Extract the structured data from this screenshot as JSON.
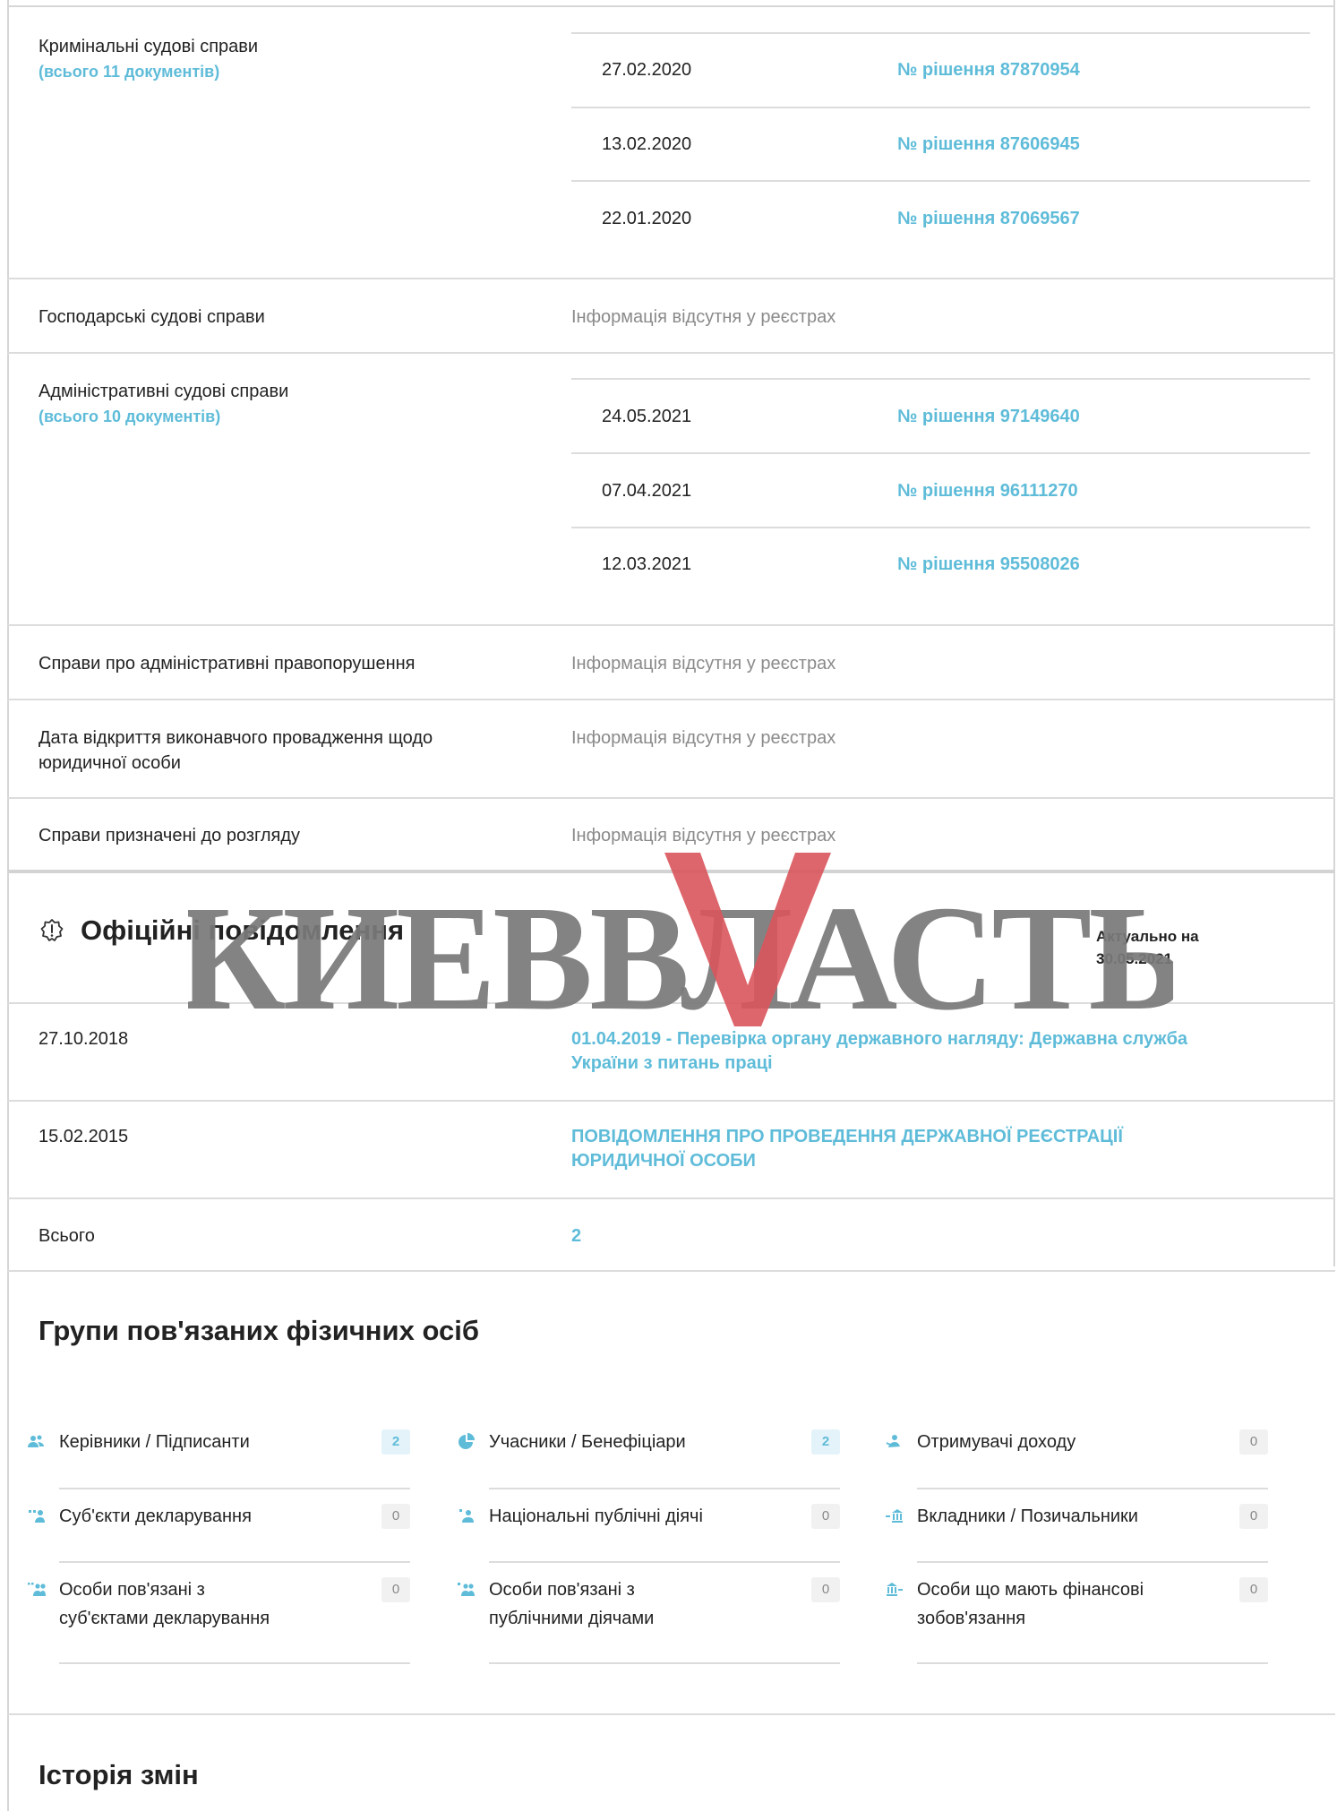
{
  "court": {
    "criminal": {
      "label": "Кримінальні судові справи",
      "count": "(всього 11 документів)",
      "rows": [
        {
          "date": "27.02.2020",
          "decision": "№ рішення 87870954"
        },
        {
          "date": "13.02.2020",
          "decision": "№ рішення 87606945"
        },
        {
          "date": "22.01.2020",
          "decision": "№ рішення 87069567"
        }
      ]
    },
    "commercial": {
      "label": "Господарські судові справи",
      "value": "Інформація відсутня у реєстрах"
    },
    "administrative": {
      "label": "Адміністративні судові справи",
      "count": "(всього 10 документів)",
      "rows": [
        {
          "date": "24.05.2021",
          "decision": "№ рішення 97149640"
        },
        {
          "date": "07.04.2021",
          "decision": "№ рішення 96111270"
        },
        {
          "date": "12.03.2021",
          "decision": "№ рішення 95508026"
        }
      ]
    },
    "offenses": {
      "label": "Справи про адміністративні правопорушення",
      "value": "Інформація відсутня у реєстрах"
    },
    "enforcement": {
      "label_line1": "Дата відкриття виконавчого провадження щодо",
      "label_line2": "юридичної особи",
      "value": "Інформація відсутня у реєстрах"
    },
    "scheduled": {
      "label": "Справи призначені до розгляду",
      "value": "Інформація відсутня у реєстрах"
    }
  },
  "notices": {
    "title": "Офіційні повідомлення",
    "actual_line1": "Актуально на",
    "actual_line2": "30.05.2021",
    "rows": [
      {
        "date": "27.10.2018",
        "line1": "01.04.2019 - Перевірка органу державного нагляду: Державна служба",
        "line2": "України з питань праці"
      },
      {
        "date": "15.02.2015",
        "line1": "ПОВІДОМЛЕННЯ ПРО ПРОВЕДЕННЯ ДЕРЖАВНОЇ РЕЄСТРАЦІЇ",
        "line2": "ЮРИДИЧНОЇ ОСОБИ"
      }
    ],
    "total_label": "Всього",
    "total_value": "2"
  },
  "groups": {
    "title": "Групи пов'язаних фізичних осіб",
    "items": [
      {
        "line1": "Керівники / Підписанти",
        "line2": "",
        "count": "2",
        "icon": "people-icon"
      },
      {
        "line1": "Учасники / Бенефіціари",
        "line2": "",
        "count": "2",
        "icon": "pie-chart-icon"
      },
      {
        "line1": "Отримувачі доходу",
        "line2": "",
        "count": "0",
        "icon": "income-person-icon"
      },
      {
        "line1": "Суб'єкти декларування",
        "line2": "",
        "count": "0",
        "icon": "declarant-icon"
      },
      {
        "line1": "Національні публічні діячі",
        "line2": "",
        "count": "0",
        "icon": "public-figure-icon"
      },
      {
        "line1": "Вкладники / Позичальники",
        "line2": "",
        "count": "0",
        "icon": "bank-depositor-icon"
      },
      {
        "line1": "Особи пов'язані з",
        "line2": "суб'єктами декларування",
        "count": "0",
        "icon": "declarant-related-icon"
      },
      {
        "line1": "Особи пов'язані з",
        "line2": "публічними діячами",
        "count": "0",
        "icon": "public-related-icon"
      },
      {
        "line1": "Особи що мають фінансові",
        "line2": "зобов'язання",
        "count": "0",
        "icon": "bank-obligation-icon"
      }
    ]
  },
  "history": {
    "title": "Історія змін"
  },
  "watermark": {
    "text": "КИЕВВЛАСТЬ"
  },
  "colors": {
    "link": "#5fbcd9",
    "watermark_gray": "#7a7a7a",
    "watermark_red": "#d9555c"
  }
}
